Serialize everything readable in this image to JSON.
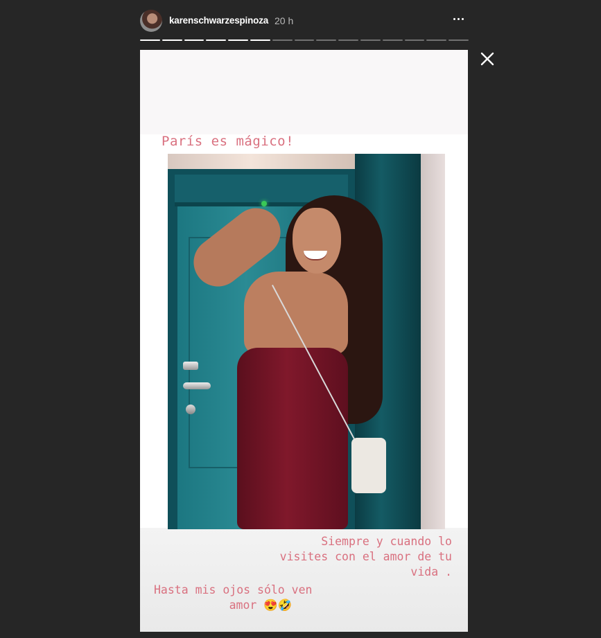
{
  "header": {
    "username": "karenschwarzespinoza",
    "timestamp": "20 h",
    "more_icon": "more-options-icon"
  },
  "progress": {
    "total_segments": 15,
    "completed_segments": 6
  },
  "media": {
    "caption_title": "París es mágico!",
    "caption_line_1": "Siempre y cuando lo\nvisites con el amor de tu\n                    vida .",
    "caption_line_2": "Hasta mis ojos sólo ven\n        amor 😍🤣"
  },
  "colors": {
    "background": "#262626",
    "caption_text": "#d9707f"
  }
}
